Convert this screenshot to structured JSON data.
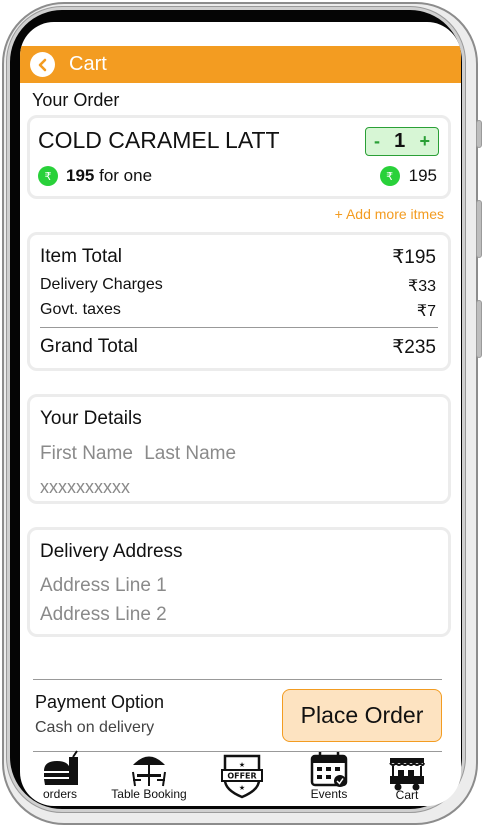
{
  "header": {
    "title": "Cart"
  },
  "order": {
    "section_title": "Your Order",
    "item_name": "COLD CARAMEL LATT",
    "quantity": "1",
    "qty_minus": "-",
    "qty_plus": "+",
    "unit_price": "195",
    "unit_suffix": "for one",
    "line_total": "195",
    "currency_icon": "₹",
    "add_more": "+ Add more itmes"
  },
  "bill": {
    "item_total_label": "Item Total",
    "item_total_value": "₹195",
    "delivery_label": "Delivery Charges",
    "delivery_value": "₹33",
    "taxes_label": "Govt. taxes",
    "taxes_value": "₹7",
    "grand_total_label": "Grand Total",
    "grand_total_value": "₹235"
  },
  "details": {
    "title": "Your Details",
    "first_name_placeholder": "First Name",
    "last_name_placeholder": "Last Name",
    "phone_placeholder": "xxxxxxxxxx"
  },
  "address": {
    "title": "Delivery Address",
    "line1_placeholder": "Address Line 1",
    "line2_placeholder": "Address Line 2"
  },
  "payment": {
    "label": "Payment Option",
    "method": "Cash on delivery",
    "place_order": "Place Order"
  },
  "nav": {
    "orders": "orders",
    "table_booking": "Table Booking",
    "offer_badge": "OFFER",
    "events": "Events",
    "cart": "Cart"
  },
  "colors": {
    "accent": "#f39c21",
    "green": "#29d13a",
    "qty_bg": "#d7f6d5"
  }
}
